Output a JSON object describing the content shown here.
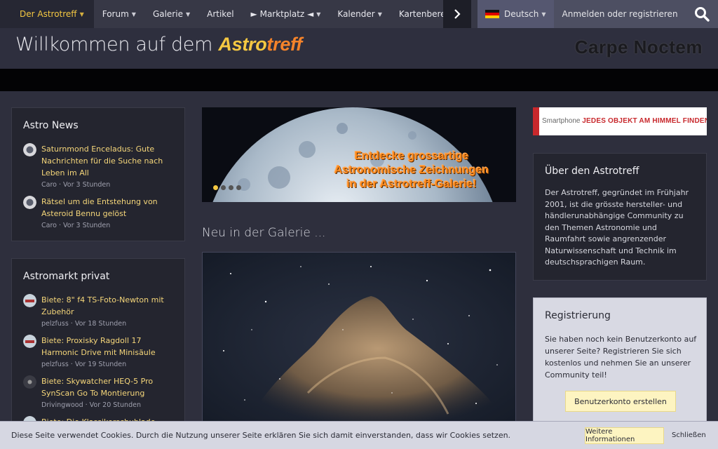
{
  "nav": {
    "items": [
      {
        "label": "Der Astrotreff",
        "chevron": true
      },
      {
        "label": "Forum",
        "chevron": true
      },
      {
        "label": "Galerie",
        "chevron": true
      },
      {
        "label": "Artikel",
        "chevron": false
      },
      {
        "label": "► Marktplatz ◄",
        "chevron": true
      },
      {
        "label": "Kalender",
        "chevron": true
      },
      {
        "label": "Kartenbereich",
        "chevron": true
      }
    ],
    "language": "Deutsch",
    "login": "Anmelden oder registrieren"
  },
  "header": {
    "welcome": "Willkommen auf dem",
    "brand_part1": "Astro",
    "brand_part2": "treff",
    "slogan": "Carpe Noctem"
  },
  "astro_news": {
    "title": "Astro News",
    "items": [
      {
        "title": "Saturnmond Enceladus: Gute Nachrichten für die Suche nach Leben im All",
        "author": "Caro",
        "time": "Vor 3 Stunden"
      },
      {
        "title": "Rätsel um die Entstehung von Asteroid Bennu gelöst",
        "author": "Caro",
        "time": "Vor 3 Stunden"
      }
    ]
  },
  "astromarkt": {
    "title": "Astromarkt privat",
    "items": [
      {
        "title": "Biete: 8\" f4 TS-Foto-Newton mit Zubehör",
        "author": "pelzfuss",
        "time": "Vor 18 Stunden"
      },
      {
        "title": "Biete: Proxisky Ragdoll 17 Harmonic Drive mit Minisäule",
        "author": "pelzfuss",
        "time": "Vor 19 Stunden"
      },
      {
        "title": "Biete: Skywatcher HEQ-5 Pro SynScan Go To Montierung",
        "author": "Drivingwood",
        "time": "Vor 20 Stunden"
      },
      {
        "title": "Biete: Die Klassikerschublade wird"
      }
    ]
  },
  "banner": {
    "line1": "Entdecke grossartige",
    "line2": "Astronomische Zeichnungen",
    "line3": "in der Astrotreff-Galerie!"
  },
  "gallery": {
    "title": "Neu in der Galerie ..."
  },
  "ad": {
    "prefix": "Smartphone",
    "text": "JEDES OBJEKT AM HIMMEL FINDEN"
  },
  "about": {
    "title": "Über den Astrotreff",
    "text": "Der Astrotreff, gegründet im Frühjahr 2001, ist die grösste hersteller- und händlerunabhängige Community zu den Themen Astronomie und Raumfahrt sowie angrenzender Naturwissenschaft und Technik im deutschsprachigen Raum."
  },
  "register": {
    "title": "Registrierung",
    "text": "Sie haben noch kein Benutzerkonto auf unserer Seite? Registrieren Sie sich kostenlos und nehmen Sie an unserer Community teil!",
    "button": "Benutzerkonto erstellen"
  },
  "cookie": {
    "text": "Diese Seite verwendet Cookies. Durch die Nutzung unserer Seite erklären Sie sich damit einverstanden, dass wir Cookies setzen.",
    "more": "Weitere Informationen",
    "close": "Schließen"
  },
  "colors": {
    "accent_yellow": "#f5c842",
    "accent_orange": "#f5832a",
    "panel_bg": "#24252f",
    "nav_bg": "#373846"
  }
}
